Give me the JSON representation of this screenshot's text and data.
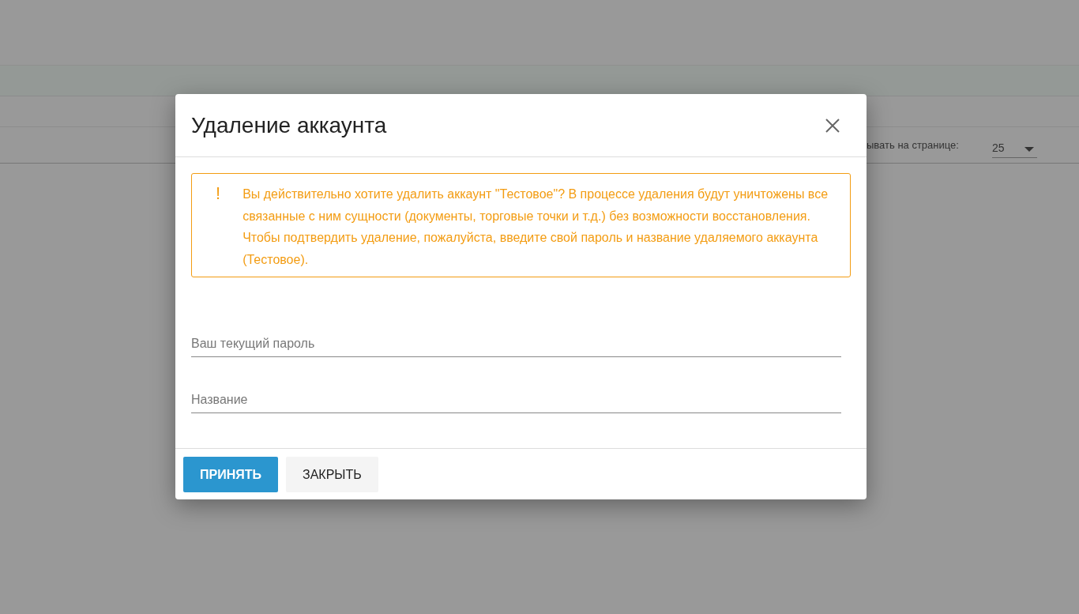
{
  "background_page": {
    "per_page_label": "ывать на странице:",
    "per_page_value": "25"
  },
  "dialog": {
    "title": "Удаление аккаунта",
    "warning": {
      "icon": "!",
      "text": "Вы действительно хотите удалить аккаунт \"Тестовое\"? В процессе удаления будут уничтожены все связанные с ним сущности (документы, торговые точки и т.д.) без возможности восстановления. Чтобы подтвердить удаление, пожалуйста, введите свой пароль и название удаляемого аккаунта (Тестовое)."
    },
    "fields": [
      {
        "placeholder": "Ваш текущий пароль"
      },
      {
        "placeholder": "Название"
      }
    ],
    "buttons": [
      {
        "label": "ПРИНЯТЬ",
        "kind": "primary"
      },
      {
        "label": "ЗАКРЫТЬ",
        "kind": "secondary"
      }
    ]
  }
}
